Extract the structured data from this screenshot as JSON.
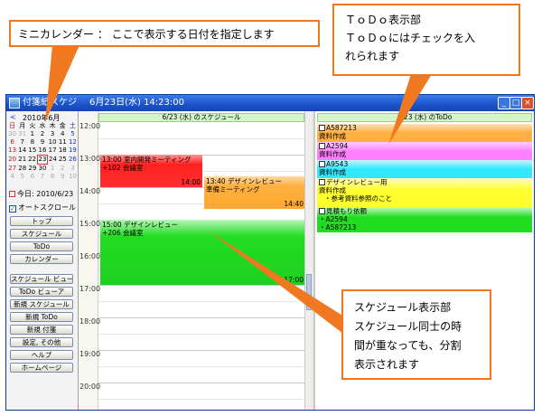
{
  "window": {
    "title": "付箋紙スケジ",
    "title_date": "6月23日(水) 14:23:00",
    "min": "_",
    "max": "□",
    "close": "×"
  },
  "mini_calendar": {
    "prev": "<",
    "month_title": "2010年6月",
    "weekdays": [
      "日",
      "月",
      "火",
      "水",
      "木",
      "金",
      "土"
    ],
    "weeks": [
      [
        "30",
        "31",
        "1",
        "2",
        "3",
        "4",
        "5"
      ],
      [
        "6",
        "7",
        "8",
        "9",
        "10",
        "11",
        "12"
      ],
      [
        "13",
        "14",
        "15",
        "16",
        "17",
        "18",
        "19"
      ],
      [
        "20",
        "21",
        "22",
        "23",
        "24",
        "25",
        "26"
      ],
      [
        "27",
        "28",
        "29",
        "30",
        "1",
        "2",
        "3"
      ],
      [
        "4",
        "5",
        "6",
        "7",
        "8",
        "9",
        "10"
      ]
    ],
    "today_label": "今日: 2010/6/23"
  },
  "auto_scroll_label": "オートスクロール",
  "nav_buttons": [
    "トップ",
    "スケジュール",
    "ToDo",
    "カレンダー"
  ],
  "action_buttons": [
    "スケジュール ビューア",
    "ToDo ビューア",
    "新規 スケジュール",
    "新規 ToDo",
    "新規 付箋",
    "設定, その他",
    "ヘルプ",
    "ホームページ"
  ],
  "schedule": {
    "header": "6/23 (水) のスケジュール",
    "hours": [
      "12:00",
      "13:00",
      "14:00",
      "15:00",
      "16:00",
      "17:00",
      "18:00",
      "19:00",
      "20:00"
    ],
    "events": [
      {
        "title": "13:00 室内開発ミーティング",
        "detail": "+102 会議室",
        "end": "14:00",
        "color": "#ff2020"
      },
      {
        "title": "13:40 デザインレビュー",
        "detail": "準備ミーティング",
        "end": "14:40",
        "color": "#ffb040"
      },
      {
        "title": "15:00 デザインレビュー",
        "detail": "+206 会議室",
        "end": "17:00",
        "color": "#22dd22"
      }
    ]
  },
  "todo": {
    "header": "6/23 (水) のToDo",
    "items": [
      {
        "line1": "A587213",
        "line2": "資料作成",
        "color": "#ffb040"
      },
      {
        "line1": "A2594",
        "line2": "資料作成",
        "color": "#ff80ff"
      },
      {
        "line1": "A9543",
        "line2": "資料作成",
        "color": "#30e8ff"
      },
      {
        "line1": "デザインレビュー用",
        "line2": "資料作成",
        "line3": "・参考資料参照のこと",
        "color": "#ffff30"
      },
      {
        "line1": "見積もり依頼",
        "line2": "・A2594",
        "line3": "・A587213",
        "color": "#20dd20"
      }
    ]
  },
  "callouts": {
    "mini_calendar": "ミニカレンダー ： ここで表示する日付を指定します",
    "todo_line1": "ＴｏＤｏ表示部",
    "todo_line2": "ＴｏＤｏにはチェックを入",
    "todo_line3": "れられます",
    "schedule_line1": "スケジュール表示部",
    "schedule_line2": "スケジュール同士の時",
    "schedule_line3": "間が重なっても、分割",
    "schedule_line4": "表示されます"
  }
}
